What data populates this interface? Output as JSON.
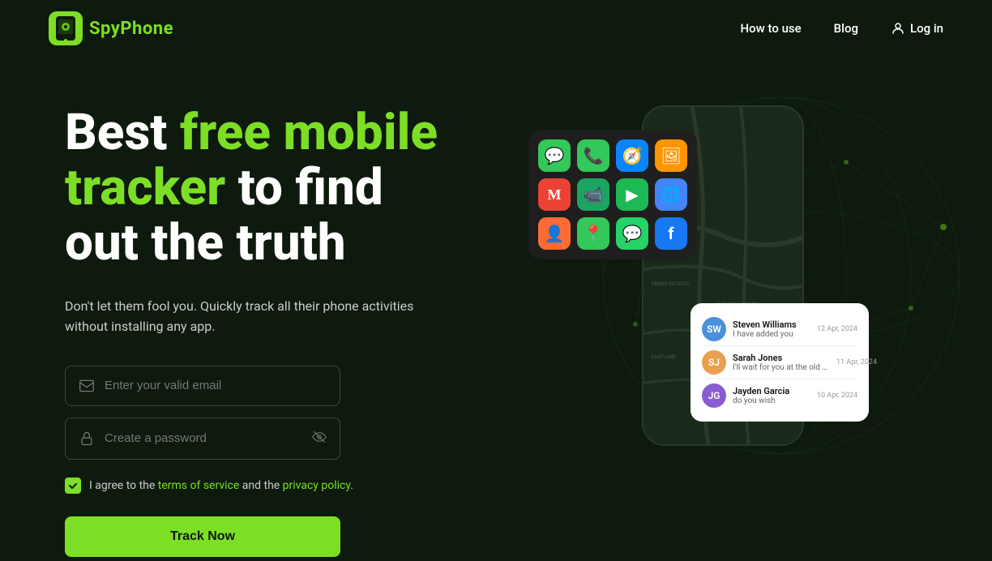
{
  "nav": {
    "logo_text": "SpyPhone",
    "how_to_use": "How to use",
    "blog": "Blog",
    "login": "Log in"
  },
  "hero": {
    "title_line1_white": "Best ",
    "title_line1_green": "free mobile",
    "title_line2_green": "tracker",
    "title_line2_white": " to find",
    "title_line3": "out the truth",
    "subtitle": "Don't let them fool you. Quickly track all their phone activities without installing any app.",
    "email_placeholder": "Enter your valid email",
    "password_placeholder": "Create a password",
    "terms_text1": "I agree to the ",
    "terms_link1": "terms of service",
    "terms_text2": " and the ",
    "terms_link2": "privacy policy",
    "terms_text3": ".",
    "track_button": "Track Now"
  },
  "messages": [
    {
      "name": "Steven Williams",
      "text": "I have added you",
      "date": "12 Apr, 2024",
      "color": "#4a90d9",
      "initials": "SW"
    },
    {
      "name": "Sarah Jones",
      "text": "I'll wait for you at the old place",
      "date": "11 Apr, 2024",
      "color": "#e8a050",
      "initials": "SJ"
    },
    {
      "name": "Jayden Garcia",
      "text": "do you wish",
      "date": "10 Apr, 2024",
      "color": "#8a5cd4",
      "initials": "JG"
    }
  ],
  "colors": {
    "green": "#7dde26",
    "dark_bg": "#0d1a0d",
    "accent": "#7dde26"
  },
  "apps": [
    {
      "icon": "💬",
      "bg": "#34c759",
      "name": "messages"
    },
    {
      "icon": "📞",
      "bg": "#34c759",
      "name": "phone"
    },
    {
      "icon": "🧭",
      "bg": "#0a84ff",
      "name": "safari"
    },
    {
      "icon": "🖼",
      "bg": "#ff9500",
      "name": "photos"
    },
    {
      "icon": "M",
      "bg": "#ea4335",
      "name": "gmail"
    },
    {
      "icon": "▶",
      "bg": "#ff0000",
      "name": "facetime"
    },
    {
      "icon": "▷",
      "bg": "#1db954",
      "name": "play"
    },
    {
      "icon": "🌐",
      "bg": "#4285f4",
      "name": "chrome"
    },
    {
      "icon": "👤",
      "bg": "#ff6b35",
      "name": "contacts"
    },
    {
      "icon": "📍",
      "bg": "#34c759",
      "name": "maps"
    },
    {
      "icon": "💬",
      "bg": "#25d366",
      "name": "whatsapp"
    },
    {
      "icon": "f",
      "bg": "#1877f2",
      "name": "facebook"
    }
  ]
}
